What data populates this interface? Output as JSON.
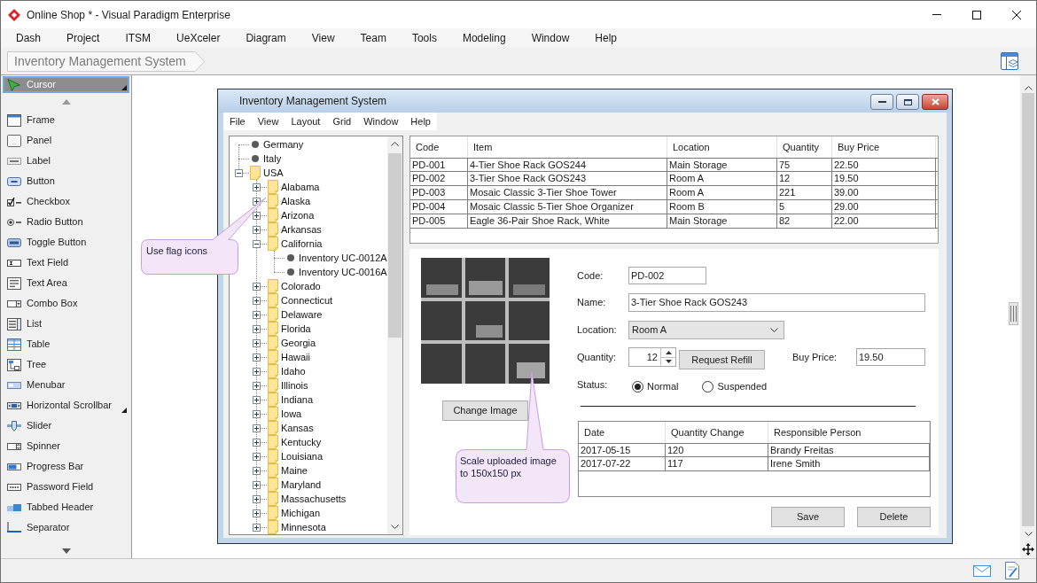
{
  "window": {
    "title": "Online Shop * - Visual Paradigm Enterprise"
  },
  "menu": [
    "Dash",
    "Project",
    "ITSM",
    "UeXceler",
    "Diagram",
    "View",
    "Team",
    "Tools",
    "Modeling",
    "Window",
    "Help"
  ],
  "breadcrumb": [
    "Inventory Management System"
  ],
  "palette": {
    "tools": [
      {
        "kind": "cursor",
        "label": "Cursor",
        "selected": true,
        "submenu": true
      }
    ],
    "items": [
      {
        "kind": "frame",
        "label": "Frame",
        "selected": false,
        "submenu": false
      },
      {
        "kind": "panel",
        "label": "Panel",
        "selected": false,
        "submenu": false
      },
      {
        "kind": "label",
        "label": "Label",
        "selected": false,
        "submenu": false
      },
      {
        "kind": "button",
        "label": "Button",
        "selected": false,
        "submenu": false
      },
      {
        "kind": "checkbox",
        "label": "Checkbox",
        "selected": false,
        "submenu": false
      },
      {
        "kind": "radio",
        "label": "Radio Button",
        "selected": false,
        "submenu": false
      },
      {
        "kind": "toggle",
        "label": "Toggle Button",
        "selected": false,
        "submenu": false
      },
      {
        "kind": "textfield",
        "label": "Text Field",
        "selected": false,
        "submenu": false
      },
      {
        "kind": "textarea",
        "label": "Text Area",
        "selected": false,
        "submenu": false
      },
      {
        "kind": "combo",
        "label": "Combo Box",
        "selected": false,
        "submenu": false
      },
      {
        "kind": "list",
        "label": "List",
        "selected": false,
        "submenu": false
      },
      {
        "kind": "table",
        "label": "Table",
        "selected": false,
        "submenu": false
      },
      {
        "kind": "tree",
        "label": "Tree",
        "selected": false,
        "submenu": false
      },
      {
        "kind": "menubar",
        "label": "Menubar",
        "selected": false,
        "submenu": false
      },
      {
        "kind": "hscrollbar",
        "label": "Horizontal Scrollbar",
        "selected": false,
        "submenu": true
      },
      {
        "kind": "slider",
        "label": "Slider",
        "selected": false,
        "submenu": false
      },
      {
        "kind": "spinner",
        "label": "Spinner",
        "selected": false,
        "submenu": false
      },
      {
        "kind": "progress",
        "label": "Progress Bar",
        "selected": false,
        "submenu": false
      },
      {
        "kind": "password",
        "label": "Password Field",
        "selected": false,
        "submenu": false
      },
      {
        "kind": "tabbed",
        "label": "Tabbed Header",
        "selected": false,
        "submenu": false
      },
      {
        "kind": "separator",
        "label": "Separator",
        "selected": false,
        "submenu": false
      }
    ]
  },
  "mockup": {
    "title": "Inventory Management System",
    "menu": [
      "File",
      "View",
      "Layout",
      "Grid",
      "Window",
      "Help"
    ],
    "tree": [
      {
        "kind": "item",
        "label": "Germany"
      },
      {
        "kind": "item",
        "label": "Italy"
      },
      {
        "kind": "folder",
        "label": "USA",
        "expanded": true,
        "children": [
          {
            "kind": "folder",
            "label": "Alabama",
            "expanded": false
          },
          {
            "kind": "folder",
            "label": "Alaska",
            "expanded": false
          },
          {
            "kind": "folder",
            "label": "Arizona",
            "expanded": false
          },
          {
            "kind": "folder",
            "label": "Arkansas",
            "expanded": false
          },
          {
            "kind": "folder",
            "label": "California",
            "expanded": true,
            "children": [
              {
                "kind": "item",
                "label": "Inventory UC-0012A"
              },
              {
                "kind": "item",
                "label": "Inventory UC-0016A"
              }
            ]
          },
          {
            "kind": "folder",
            "label": "Colorado",
            "expanded": false
          },
          {
            "kind": "folder",
            "label": "Connecticut",
            "expanded": false
          },
          {
            "kind": "folder",
            "label": "Delaware",
            "expanded": false
          },
          {
            "kind": "folder",
            "label": "Florida",
            "expanded": false
          },
          {
            "kind": "folder",
            "label": "Georgia",
            "expanded": false
          },
          {
            "kind": "folder",
            "label": "Hawaii",
            "expanded": false
          },
          {
            "kind": "folder",
            "label": "Idaho",
            "expanded": false
          },
          {
            "kind": "folder",
            "label": "Illinois",
            "expanded": false
          },
          {
            "kind": "folder",
            "label": "Indiana",
            "expanded": false
          },
          {
            "kind": "folder",
            "label": "Iowa",
            "expanded": false
          },
          {
            "kind": "folder",
            "label": "Kansas",
            "expanded": false
          },
          {
            "kind": "folder",
            "label": "Kentucky",
            "expanded": false
          },
          {
            "kind": "folder",
            "label": "Louisiana",
            "expanded": false
          },
          {
            "kind": "folder",
            "label": "Maine",
            "expanded": false
          },
          {
            "kind": "folder",
            "label": "Maryland",
            "expanded": false
          },
          {
            "kind": "folder",
            "label": "Massachusetts",
            "expanded": false
          },
          {
            "kind": "folder",
            "label": "Michigan",
            "expanded": false
          },
          {
            "kind": "folder",
            "label": "Minnesota",
            "expanded": false
          }
        ]
      }
    ],
    "table": {
      "columns": [
        "Code",
        "Item",
        "Location",
        "Quantity",
        "Buy Price"
      ],
      "rows": [
        [
          "PD-001",
          "4-Tier Shoe Rack GOS244",
          "Main Storage",
          "75",
          "22.50"
        ],
        [
          "PD-002",
          "3-Tier Shoe Rack GOS243",
          "Room A",
          "12",
          "19.50"
        ],
        [
          "PD-003",
          "Mosaic Classic 3-Tier Shoe Tower",
          "Room A",
          "221",
          "39.00"
        ],
        [
          "PD-004",
          "Mosaic Classic 5-Tier Shoe Organizer",
          "Room B",
          "5",
          "29.00"
        ],
        [
          "PD-005",
          "Eagle 36-Pair Shoe Rack, White",
          "Main Storage",
          "82",
          "22.00"
        ]
      ]
    },
    "image_button": "Change Image",
    "form": {
      "code": {
        "label": "Code:",
        "value": "PD-002"
      },
      "name": {
        "label": "Name:",
        "value": "3-Tier Shoe Rack GOS243"
      },
      "location": {
        "label": "Location:",
        "value": "Room A"
      },
      "quantity": {
        "label": "Quantity:",
        "value": "12"
      },
      "refill_button": "Request Refill",
      "buy_price": {
        "label": "Buy Price:",
        "value": "19.50"
      },
      "status": {
        "label": "Status:",
        "options": [
          {
            "label": "Normal",
            "selected": true
          },
          {
            "label": "Suspended",
            "selected": false
          }
        ]
      }
    },
    "history": {
      "columns": [
        "Date",
        "Quantity Change",
        "Responsible Person"
      ],
      "rows": [
        [
          "2017-05-15",
          "120",
          "Brandy Freitas"
        ],
        [
          "2017-07-22",
          "117",
          "Irene Smith"
        ]
      ]
    },
    "buttons": [
      "Save",
      "Delete"
    ]
  },
  "notes": [
    "Use flag icons",
    "Scale uploaded image to 150x150 px"
  ]
}
